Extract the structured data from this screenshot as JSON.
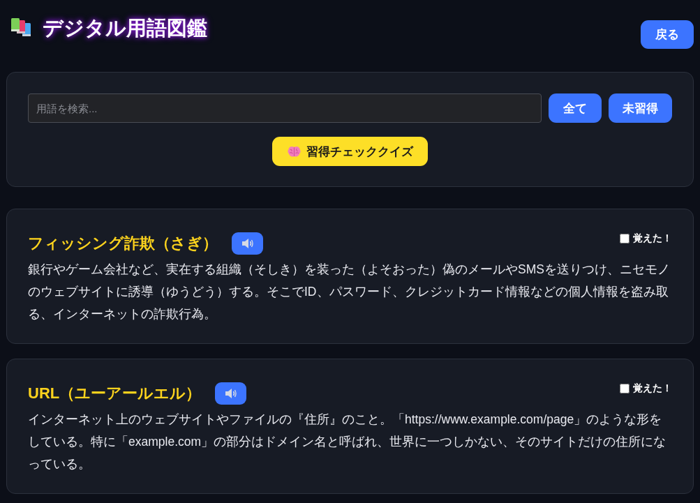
{
  "header": {
    "title": "デジタル用語図鑑",
    "back_button": "戻る"
  },
  "search": {
    "placeholder": "用語を検索...",
    "filters": [
      "全て",
      "未習得"
    ],
    "quiz_button": "習得チェッククイズ"
  },
  "terms": [
    {
      "title": "フィッシング詐欺（さぎ）",
      "description": "銀行やゲーム会社など、実在する組織（そしき）を装った（よそおった）偽のメールやSMSを送りつけ、ニセモノのウェブサイトに誘導（ゆうどう）する。そこでID、パスワード、クレジットカード情報などの個人情報を盗み取る、インターネットの詐欺行為。",
      "learned": false,
      "learned_label": "覚えた！"
    },
    {
      "title": "URL（ユーアールエル）",
      "description": "インターネット上のウェブサイトやファイルの『住所』のこと。「https://www.example.com/page」のような形をしている。特に「example.com」の部分はドメイン名と呼ばれ、世界に一つしかない、そのサイトだけの住所になっている。",
      "learned": false,
      "learned_label": "覚えた！"
    }
  ]
}
